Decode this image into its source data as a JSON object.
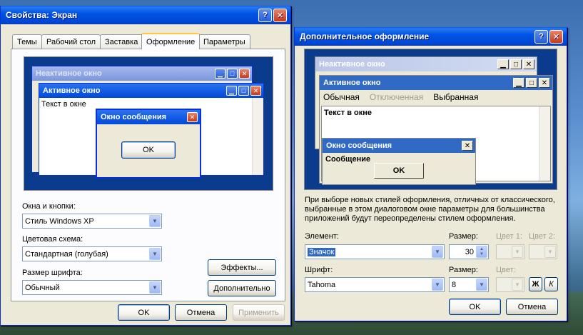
{
  "main_dialog": {
    "title": "Свойства: Экран",
    "help_btn": "?",
    "close_btn": "✕",
    "tabs": [
      "Темы",
      "Рабочий стол",
      "Заставка",
      "Оформление",
      "Параметры"
    ],
    "active_tab_index": 3,
    "preview": {
      "inactive_title": "Неактивное окно",
      "active_title": "Активное окно",
      "window_text": "Текст в окне",
      "message_title": "Окно сообщения",
      "ok_label": "OK"
    },
    "windows_buttons_label": "Окна и кнопки:",
    "windows_buttons_value": "Стиль Windows XP",
    "color_scheme_label": "Цветовая схема:",
    "color_scheme_value": "Стандартная (голубая)",
    "font_size_label": "Размер шрифта:",
    "font_size_value": "Обычный",
    "effects_button": "Эффекты...",
    "advanced_button": "Дополнительно",
    "ok_button": "OK",
    "cancel_button": "Отмена",
    "apply_button": "Применить"
  },
  "advanced_dialog": {
    "title": "Дополнительное оформление",
    "help_btn": "?",
    "close_btn": "✕",
    "preview": {
      "inactive_title": "Неактивное окно",
      "active_title": "Активное окно",
      "menu_normal": "Обычная",
      "menu_disabled": "Отключенная",
      "menu_selected": "Выбранная",
      "window_text": "Текст в окне",
      "message_title": "Окно сообщения",
      "message_text": "Сообщение",
      "ok_label": "OK"
    },
    "description": "При выборе новых стилей оформления, отличных от классического, выбранные в этом диалоговом окне параметры для большинства приложений будут переопределены стилем оформления.",
    "element_label": "Элемент:",
    "element_value": "Значок",
    "size_label": "Размер:",
    "size_value": "30",
    "color1_label": "Цвет 1:",
    "color2_label": "Цвет 2:",
    "font_label": "Шрифт:",
    "font_value": "Tahoma",
    "font_size_label": "Размер:",
    "font_size_value": "8",
    "font_color_label": "Цвет:",
    "bold_label": "Ж",
    "italic_label": "К",
    "ok_button": "OK",
    "cancel_button": "Отмена"
  },
  "colors": {
    "xp_blue": "#0055e5",
    "dialog_bg": "#ece9d8",
    "preview_bg": "#0a3b8c",
    "selection": "#316ac5"
  }
}
